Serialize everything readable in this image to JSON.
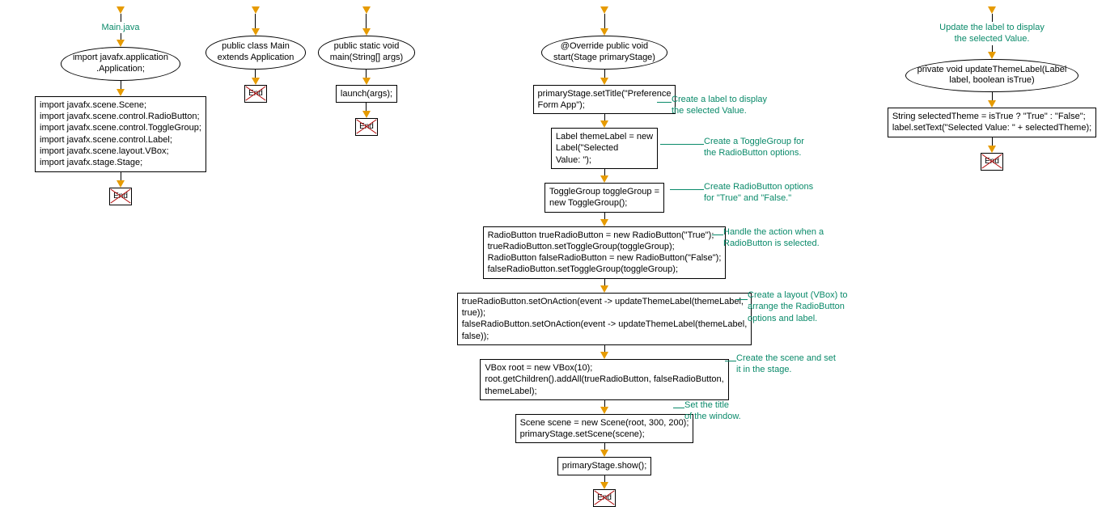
{
  "col1": {
    "title": "Main.java",
    "ellipse": "import javafx.application\n.Application;",
    "box": "import javafx.scene.Scene;\nimport javafx.scene.control.RadioButton;\nimport javafx.scene.control.ToggleGroup;\nimport javafx.scene.control.Label;\nimport javafx.scene.layout.VBox;\nimport javafx.stage.Stage;",
    "end": "End"
  },
  "col2": {
    "ellipse": "public class Main\nextends Application",
    "end": "End"
  },
  "col3": {
    "ellipse": "public static void\nmain(String[] args)",
    "box": "launch(args);",
    "end": "End"
  },
  "col4": {
    "ellipse": "@Override public void\nstart(Stage primaryStage)",
    "b1": "primaryStage.setTitle(\"Preference\nForm App\");",
    "a1": "Create a label to display\nthe selected Value.",
    "b2": "Label themeLabel = new\nLabel(\"Selected\nValue: \");",
    "a2": "Create a ToggleGroup for\nthe RadioButton options.",
    "b3": "ToggleGroup toggleGroup =\nnew ToggleGroup();",
    "a3": "Create RadioButton options\nfor \"True\" and \"False.\"",
    "b4": "RadioButton trueRadioButton = new RadioButton(\"True\");\ntrueRadioButton.setToggleGroup(toggleGroup);\nRadioButton falseRadioButton = new RadioButton(\"False\");\nfalseRadioButton.setToggleGroup(toggleGroup);",
    "a4": "Handle the action when a\nRadioButton is selected.",
    "b5": "trueRadioButton.setOnAction(event -> updateThemeLabel(themeLabel,\ntrue));\nfalseRadioButton.setOnAction(event -> updateThemeLabel(themeLabel,\nfalse));",
    "a5": "Create a layout (VBox) to\narrange the RadioButton\noptions and label.",
    "b6": "VBox root = new VBox(10);\nroot.getChildren().addAll(trueRadioButton, falseRadioButton,\nthemeLabel);",
    "a6": "Create the scene and set\nit in the stage.",
    "b7": "Scene scene = new Scene(root, 300, 200);\nprimaryStage.setScene(scene);",
    "a7": "Set the title\nof the window.",
    "b8": "primaryStage.show();",
    "end": "End"
  },
  "col5": {
    "annot": "Update the label to display\nthe selected Value.",
    "ellipse": "private void updateThemeLabel(Label\nlabel, boolean isTrue)",
    "box": "String selectedTheme = isTrue ? \"True\" : \"False\";\nlabel.setText(\"Selected Value: \" + selectedTheme);",
    "end": "End"
  }
}
